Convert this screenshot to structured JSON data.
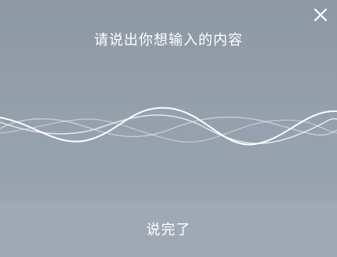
{
  "prompt_text": "请说出你想输入的内容",
  "done_label": "说完了",
  "close_icon": "close-icon",
  "waveform_icon": "voice-waveform",
  "colors": {
    "background_top": "#8d98a5",
    "background_bottom": "#9aa5b2",
    "footer": "#9fa9b5",
    "text": "#ffffff",
    "wave_primary": "#ffffff",
    "wave_secondary": "#d7dde4"
  }
}
